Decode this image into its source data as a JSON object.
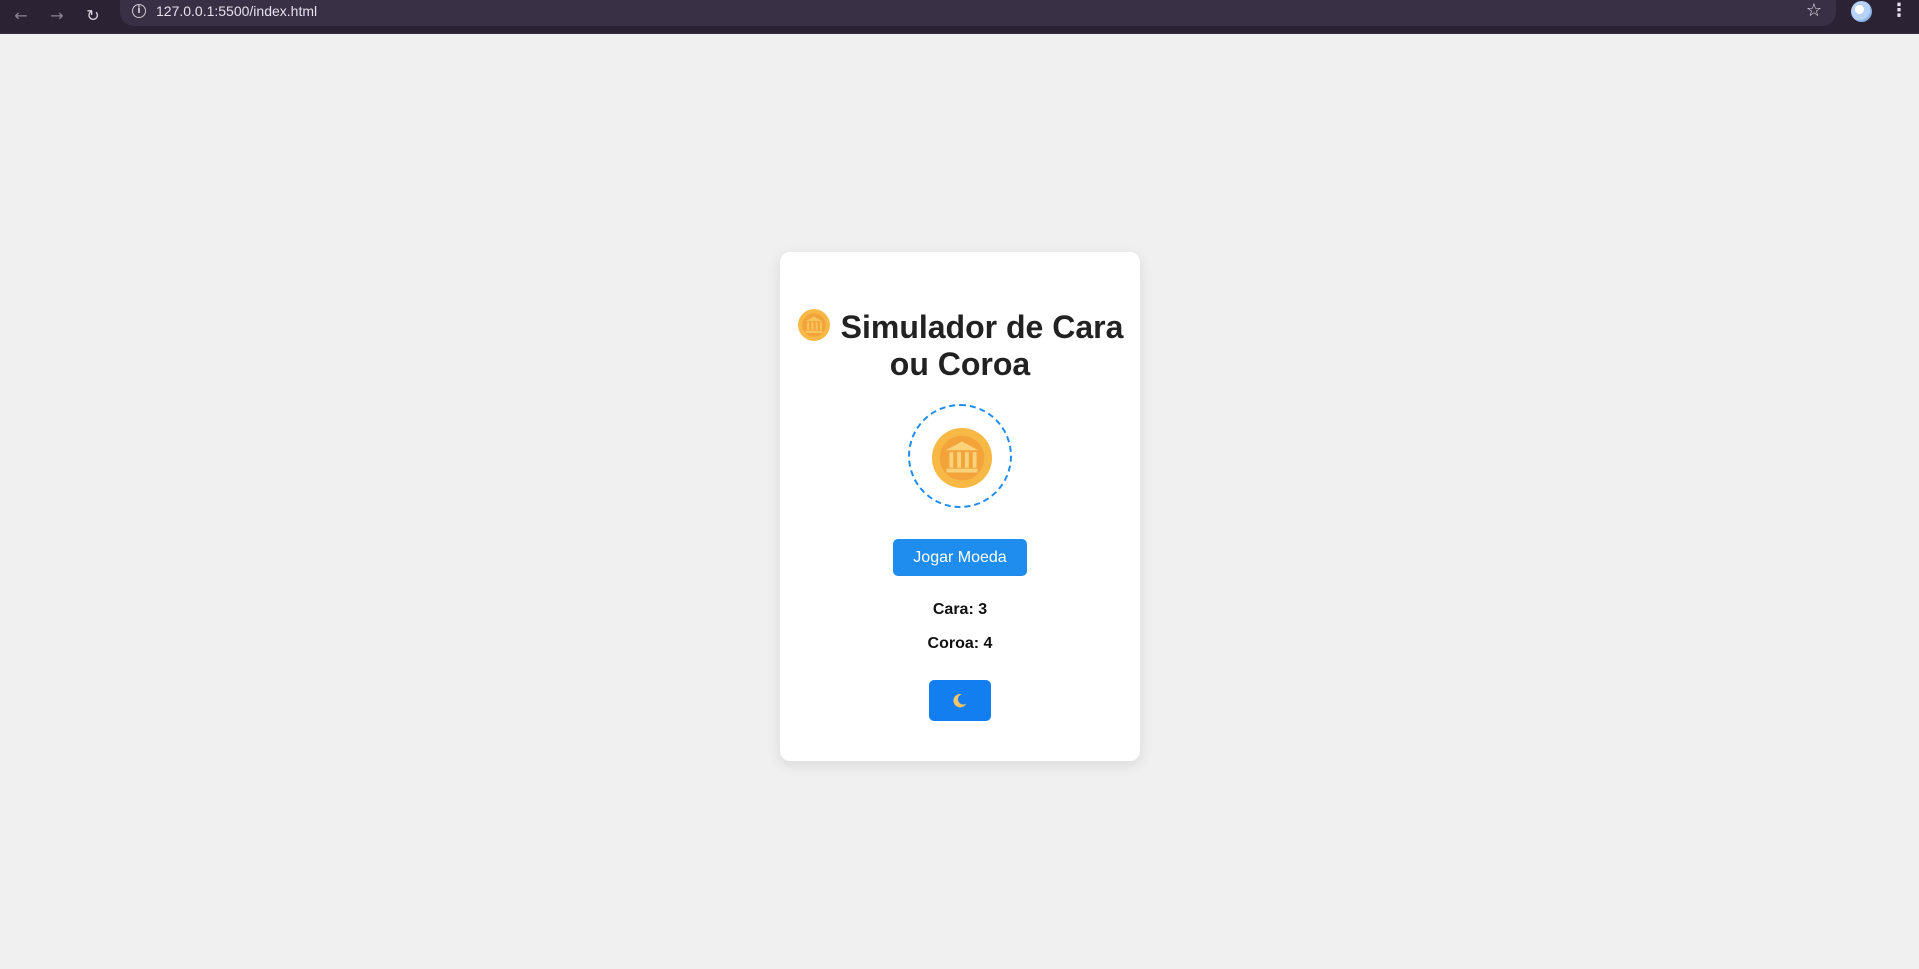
{
  "browser": {
    "url": "127.0.0.1:5500/index.html",
    "icons": {
      "back": "arrow-left-icon",
      "forward": "arrow-right-icon",
      "reload": "reload-icon",
      "info": "info-icon",
      "bookmark": "star-icon",
      "menu": "kebab-menu-icon"
    }
  },
  "app": {
    "title": "Simulador de Cara ou Coroa",
    "title_icon": "coin-icon",
    "coin_icon": "coin-bank-icon",
    "flip_button_label": "Jogar Moeda",
    "counts": {
      "cara": "Cara: 3",
      "coroa": "Coroa: 4"
    },
    "theme_toggle_icon": "crescent-moon-icon"
  },
  "colors": {
    "background": "#f0f0f0",
    "accent": "#1f8ded",
    "theme_button": "#137ef0",
    "coin_outer": "#f7b846",
    "coin_inner": "#f2a33a"
  }
}
